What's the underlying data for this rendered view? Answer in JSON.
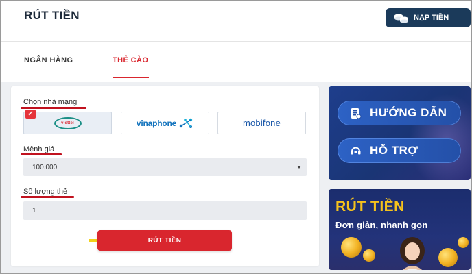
{
  "header": {
    "title": "RÚT TIỀN",
    "topup_label": "NẠP TIỀN"
  },
  "tabs": [
    {
      "label": "NGÂN HÀNG",
      "active": false
    },
    {
      "label": "THẺ CÀO",
      "active": true
    }
  ],
  "form": {
    "carrier_label": "Chọn nhà mạng",
    "carriers": [
      {
        "logo_text": "viettel",
        "selected": true
      },
      {
        "logo_text": "vinaphone",
        "selected": false
      },
      {
        "logo_text": "mobifone",
        "selected": false
      }
    ],
    "denomination_label": "Mệnh giá",
    "denomination_value": "100.000",
    "quantity_label": "Số lượng thẻ",
    "quantity_value": "1",
    "submit_label": "RÚT TIỀN"
  },
  "banners": {
    "guide_label": "HƯỚNG DẪN",
    "support_label": "HỖ TRỢ",
    "promo_title": "RÚT TIỀN",
    "promo_subtitle": "Đơn giản, nhanh gọn"
  },
  "colors": {
    "accent": "#d9262e",
    "navy": "#1b3a5a",
    "banner_blue": "#1e3e8c",
    "promo_yellow": "#f6c21c"
  },
  "icons": {
    "topup": "coins-icon",
    "selected": "check-icon",
    "guide": "guide-book-icon",
    "support": "headset-icon",
    "pointer": "yellow-arrow-icon"
  }
}
